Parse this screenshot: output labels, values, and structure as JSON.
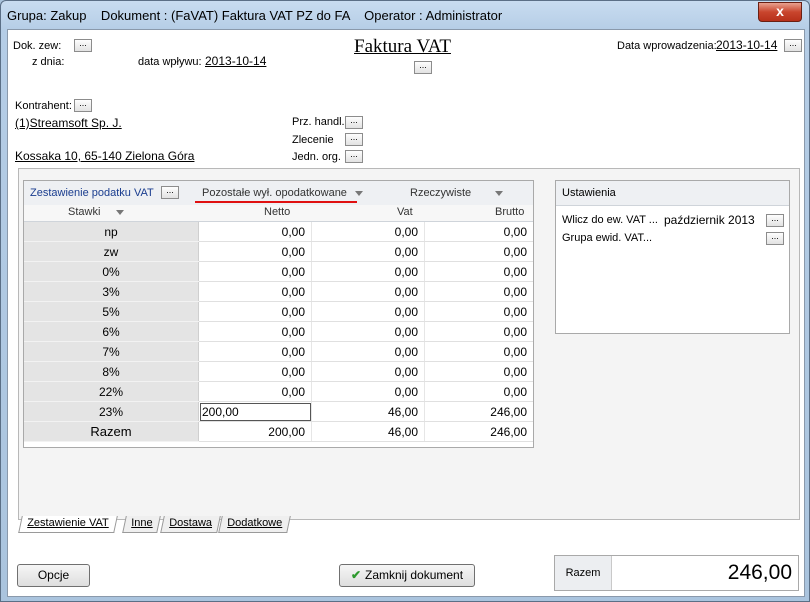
{
  "window": {
    "title": "Grupa: Zakup    Dokument : (FaVAT) Faktura VAT PZ do FA    Operator : Administrator",
    "close": "x"
  },
  "header": {
    "dok_zew_label": "Dok. zew:",
    "z_dnia_label": "z dnia:",
    "data_wplywu_label": "data wpływu:",
    "data_wplywu_value": "2013-10-14",
    "doc_title": "Faktura VAT",
    "data_wprowadzenia_label": "Data wprowadzenia:",
    "data_wprowadzenia_value": "2013-10-14",
    "dots": "..."
  },
  "kontrahent": {
    "label": "Kontrahent:",
    "name": "(1)Streamsoft Sp. J.",
    "address": "Kossaka 10, 65-140 Zielona Góra"
  },
  "right_fields": {
    "prz_handl": "Prz. handl.",
    "zlecenie": "Zlecenie",
    "jedn_org": "Jedn. org."
  },
  "vat_table": {
    "title": "Zestawienie podatku VAT",
    "filter1": "Pozostałe wył. opodatkowane",
    "filter2": "Rzeczywiste",
    "columns": [
      "Stawki",
      "Netto",
      "Vat",
      "Brutto"
    ],
    "rows": [
      {
        "rate": "np",
        "netto": "0,00",
        "vat": "0,00",
        "brutto": "0,00"
      },
      {
        "rate": "zw",
        "netto": "0,00",
        "vat": "0,00",
        "brutto": "0,00"
      },
      {
        "rate": "0%",
        "netto": "0,00",
        "vat": "0,00",
        "brutto": "0,00"
      },
      {
        "rate": "3%",
        "netto": "0,00",
        "vat": "0,00",
        "brutto": "0,00"
      },
      {
        "rate": "5%",
        "netto": "0,00",
        "vat": "0,00",
        "brutto": "0,00"
      },
      {
        "rate": "6%",
        "netto": "0,00",
        "vat": "0,00",
        "brutto": "0,00"
      },
      {
        "rate": "7%",
        "netto": "0,00",
        "vat": "0,00",
        "brutto": "0,00"
      },
      {
        "rate": "8%",
        "netto": "0,00",
        "vat": "0,00",
        "brutto": "0,00"
      },
      {
        "rate": "22%",
        "netto": "0,00",
        "vat": "0,00",
        "brutto": "0,00"
      },
      {
        "rate": "23%",
        "netto": "200,00",
        "vat": "46,00",
        "brutto": "246,00"
      },
      {
        "rate": "Razem",
        "netto": "200,00",
        "vat": "46,00",
        "brutto": "246,00"
      }
    ]
  },
  "settings": {
    "title": "Ustawienia",
    "wlicz_label": "Wlicz do ew. VAT ...",
    "wlicz_value": "październik 2013",
    "grupa_label": "Grupa ewid. VAT..."
  },
  "tabs": [
    "Zestawienie VAT",
    "Inne",
    "Dostawa",
    "Dodatkowe"
  ],
  "buttons": {
    "opcje": "Opcje",
    "zamknij": "Zamknij dokument"
  },
  "razem": {
    "label": "Razem",
    "value": "246,00"
  },
  "colors": {
    "accent_red": "#e01010",
    "check_green": "#2e9a2e"
  }
}
